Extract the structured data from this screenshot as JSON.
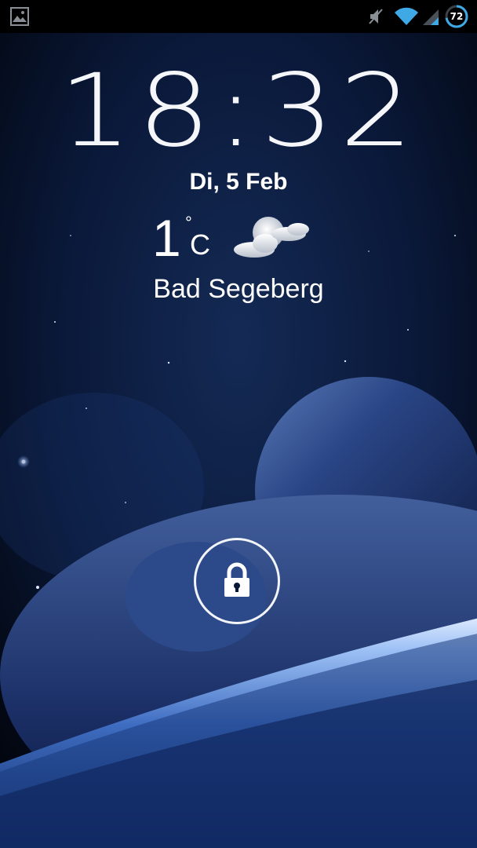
{
  "statusbar": {
    "left_icons": [
      "gallery-notification-icon"
    ],
    "right_icons": [
      "muted-icon",
      "wifi-icon",
      "signal-icon",
      "battery-icon"
    ],
    "battery_percent": "72"
  },
  "lockscreen": {
    "time": "18:32",
    "date": "Di, 5 Feb",
    "weather": {
      "temperature": "1",
      "degree_symbol": "°",
      "unit": "C",
      "condition_icon": "moon-cloud-icon"
    },
    "location": "Bad Segeberg",
    "unlock_icon": "lock-icon"
  },
  "colors": {
    "background": "#050b1a",
    "statusbar": "#000000",
    "wifi": "#3fa9e6",
    "text": "#ffffff"
  }
}
